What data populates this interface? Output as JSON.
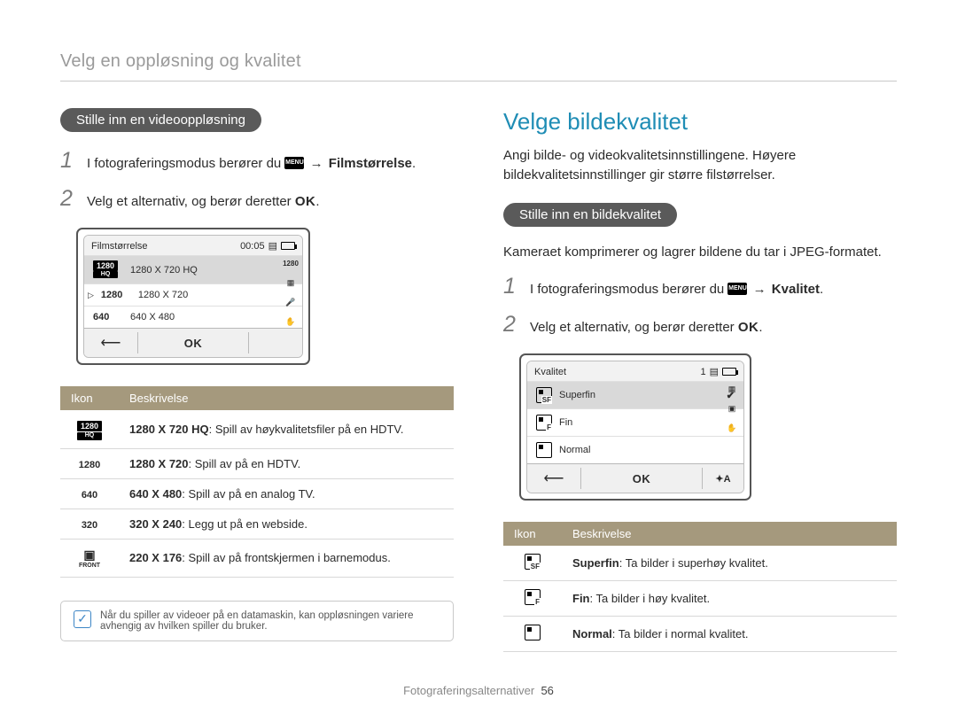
{
  "breadcrumb": "Velg en oppløsning og kvalitet",
  "footer": {
    "section": "Fotograferingsalternativer",
    "page": "56"
  },
  "left": {
    "pill": "Stille inn en videooppløsning",
    "step1_pre": "I fotograferingsmodus berører du ",
    "menu_chip": "MENU",
    "arrow": "→",
    "step1_bold": "Filmstørrelse",
    "step2_pre": "Velg et alternativ, og berør deretter ",
    "ok_chip": "OK",
    "lcd": {
      "title": "Filmstørrelse",
      "timer": "00:05",
      "rows": [
        {
          "badge_main": "1280",
          "badge_sub": "HQ",
          "label": "1280 X 720 HQ",
          "selected": true
        },
        {
          "badge_main": "1280",
          "badge_sub": "",
          "label": "1280 X 720",
          "selected": false,
          "pointer": true
        },
        {
          "badge_main": "640",
          "badge_sub": "",
          "label": "640 X 480",
          "selected": false
        }
      ],
      "ok": "OK"
    },
    "table": {
      "h1": "Ikon",
      "h2": "Beskrivelse",
      "rows": [
        {
          "icon": "1280hq",
          "bold": "1280 X 720 HQ",
          "rest": ": Spill av høykvalitetsfiler på en HDTV."
        },
        {
          "icon": "1280",
          "bold": "1280 X 720",
          "rest": ": Spill av på en HDTV."
        },
        {
          "icon": "640",
          "bold": "640 X 480",
          "rest": ": Spill av på en analog TV."
        },
        {
          "icon": "320",
          "bold": "320 X 240",
          "rest": ": Legg ut på en webside."
        },
        {
          "icon": "front",
          "bold": "220 X 176",
          "rest": ": Spill av på frontskjermen i barnemodus."
        }
      ]
    },
    "note": "Når du spiller av videoer på en datamaskin, kan oppløsningen variere avhengig av hvilken spiller du bruker."
  },
  "right": {
    "h2": "Velge bildekvalitet",
    "para": "Angi bilde- og videokvalitetsinnstillingene. Høyere bildekvalitetsinnstillinger gir større filstørrelser.",
    "pill": "Stille inn en bildekvalitet",
    "intro": "Kameraet komprimerer og lagrer bildene du tar i JPEG-formatet.",
    "step1_pre": "I fotograferingsmodus berører du ",
    "menu_chip": "MENU",
    "arrow": "→",
    "step1_bold": "Kvalitet",
    "step2_pre": "Velg et alternativ, og berør deretter ",
    "ok_chip": "OK",
    "lcd": {
      "title": "Kvalitet",
      "count": "1",
      "rows": [
        {
          "sub": "SF",
          "label": "Superfin",
          "selected": true
        },
        {
          "sub": "F",
          "label": "Fin",
          "selected": false
        },
        {
          "sub": "",
          "label": "Normal",
          "selected": false
        }
      ],
      "ok": "OK",
      "flash": "✦A"
    },
    "table": {
      "h1": "Ikon",
      "h2": "Beskrivelse",
      "rows": [
        {
          "sub": "SF",
          "bold": "Superfin",
          "rest": ": Ta bilder i superhøy kvalitet."
        },
        {
          "sub": "F",
          "bold": "Fin",
          "rest": ": Ta bilder i høy kvalitet."
        },
        {
          "sub": "",
          "bold": "Normal",
          "rest": ": Ta bilder i normal kvalitet."
        }
      ]
    }
  }
}
